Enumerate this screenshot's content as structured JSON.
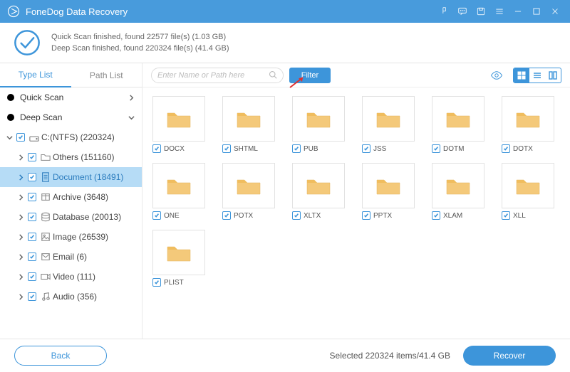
{
  "titlebar": {
    "title": "FoneDog Data Recovery"
  },
  "summary": {
    "line1": "Quick Scan finished, found 22577 file(s) (1.03 GB)",
    "line2": "Deep Scan finished, found 220324 file(s) (41.4 GB)"
  },
  "sidebar": {
    "tabs": {
      "type_list": "Type List",
      "path_list": "Path List"
    },
    "quick_scan": "Quick Scan",
    "deep_scan": "Deep Scan",
    "drive": "C:(NTFS) (220324)",
    "categories": [
      {
        "label": "Others (151160)",
        "icon": "folder"
      },
      {
        "label": "Document (18491)",
        "icon": "document",
        "selected": true
      },
      {
        "label": "Archive (3648)",
        "icon": "archive"
      },
      {
        "label": "Database (20013)",
        "icon": "database"
      },
      {
        "label": "Image (26539)",
        "icon": "image"
      },
      {
        "label": "Email (6)",
        "icon": "email"
      },
      {
        "label": "Video (111)",
        "icon": "video"
      },
      {
        "label": "Audio (356)",
        "icon": "audio"
      }
    ]
  },
  "toolbar": {
    "search_placeholder": "Enter Name or Path here",
    "filter_label": "Filter"
  },
  "grid": {
    "items": [
      {
        "label": "DOCX"
      },
      {
        "label": "SHTML"
      },
      {
        "label": "PUB"
      },
      {
        "label": "JSS"
      },
      {
        "label": "DOTM"
      },
      {
        "label": "DOTX"
      },
      {
        "label": "ONE"
      },
      {
        "label": "POTX"
      },
      {
        "label": "XLTX"
      },
      {
        "label": "PPTX"
      },
      {
        "label": "XLAM"
      },
      {
        "label": "XLL"
      },
      {
        "label": "PLIST"
      }
    ]
  },
  "footer": {
    "back_label": "Back",
    "selected_text": "Selected 220324 items/41.4 GB",
    "recover_label": "Recover"
  }
}
